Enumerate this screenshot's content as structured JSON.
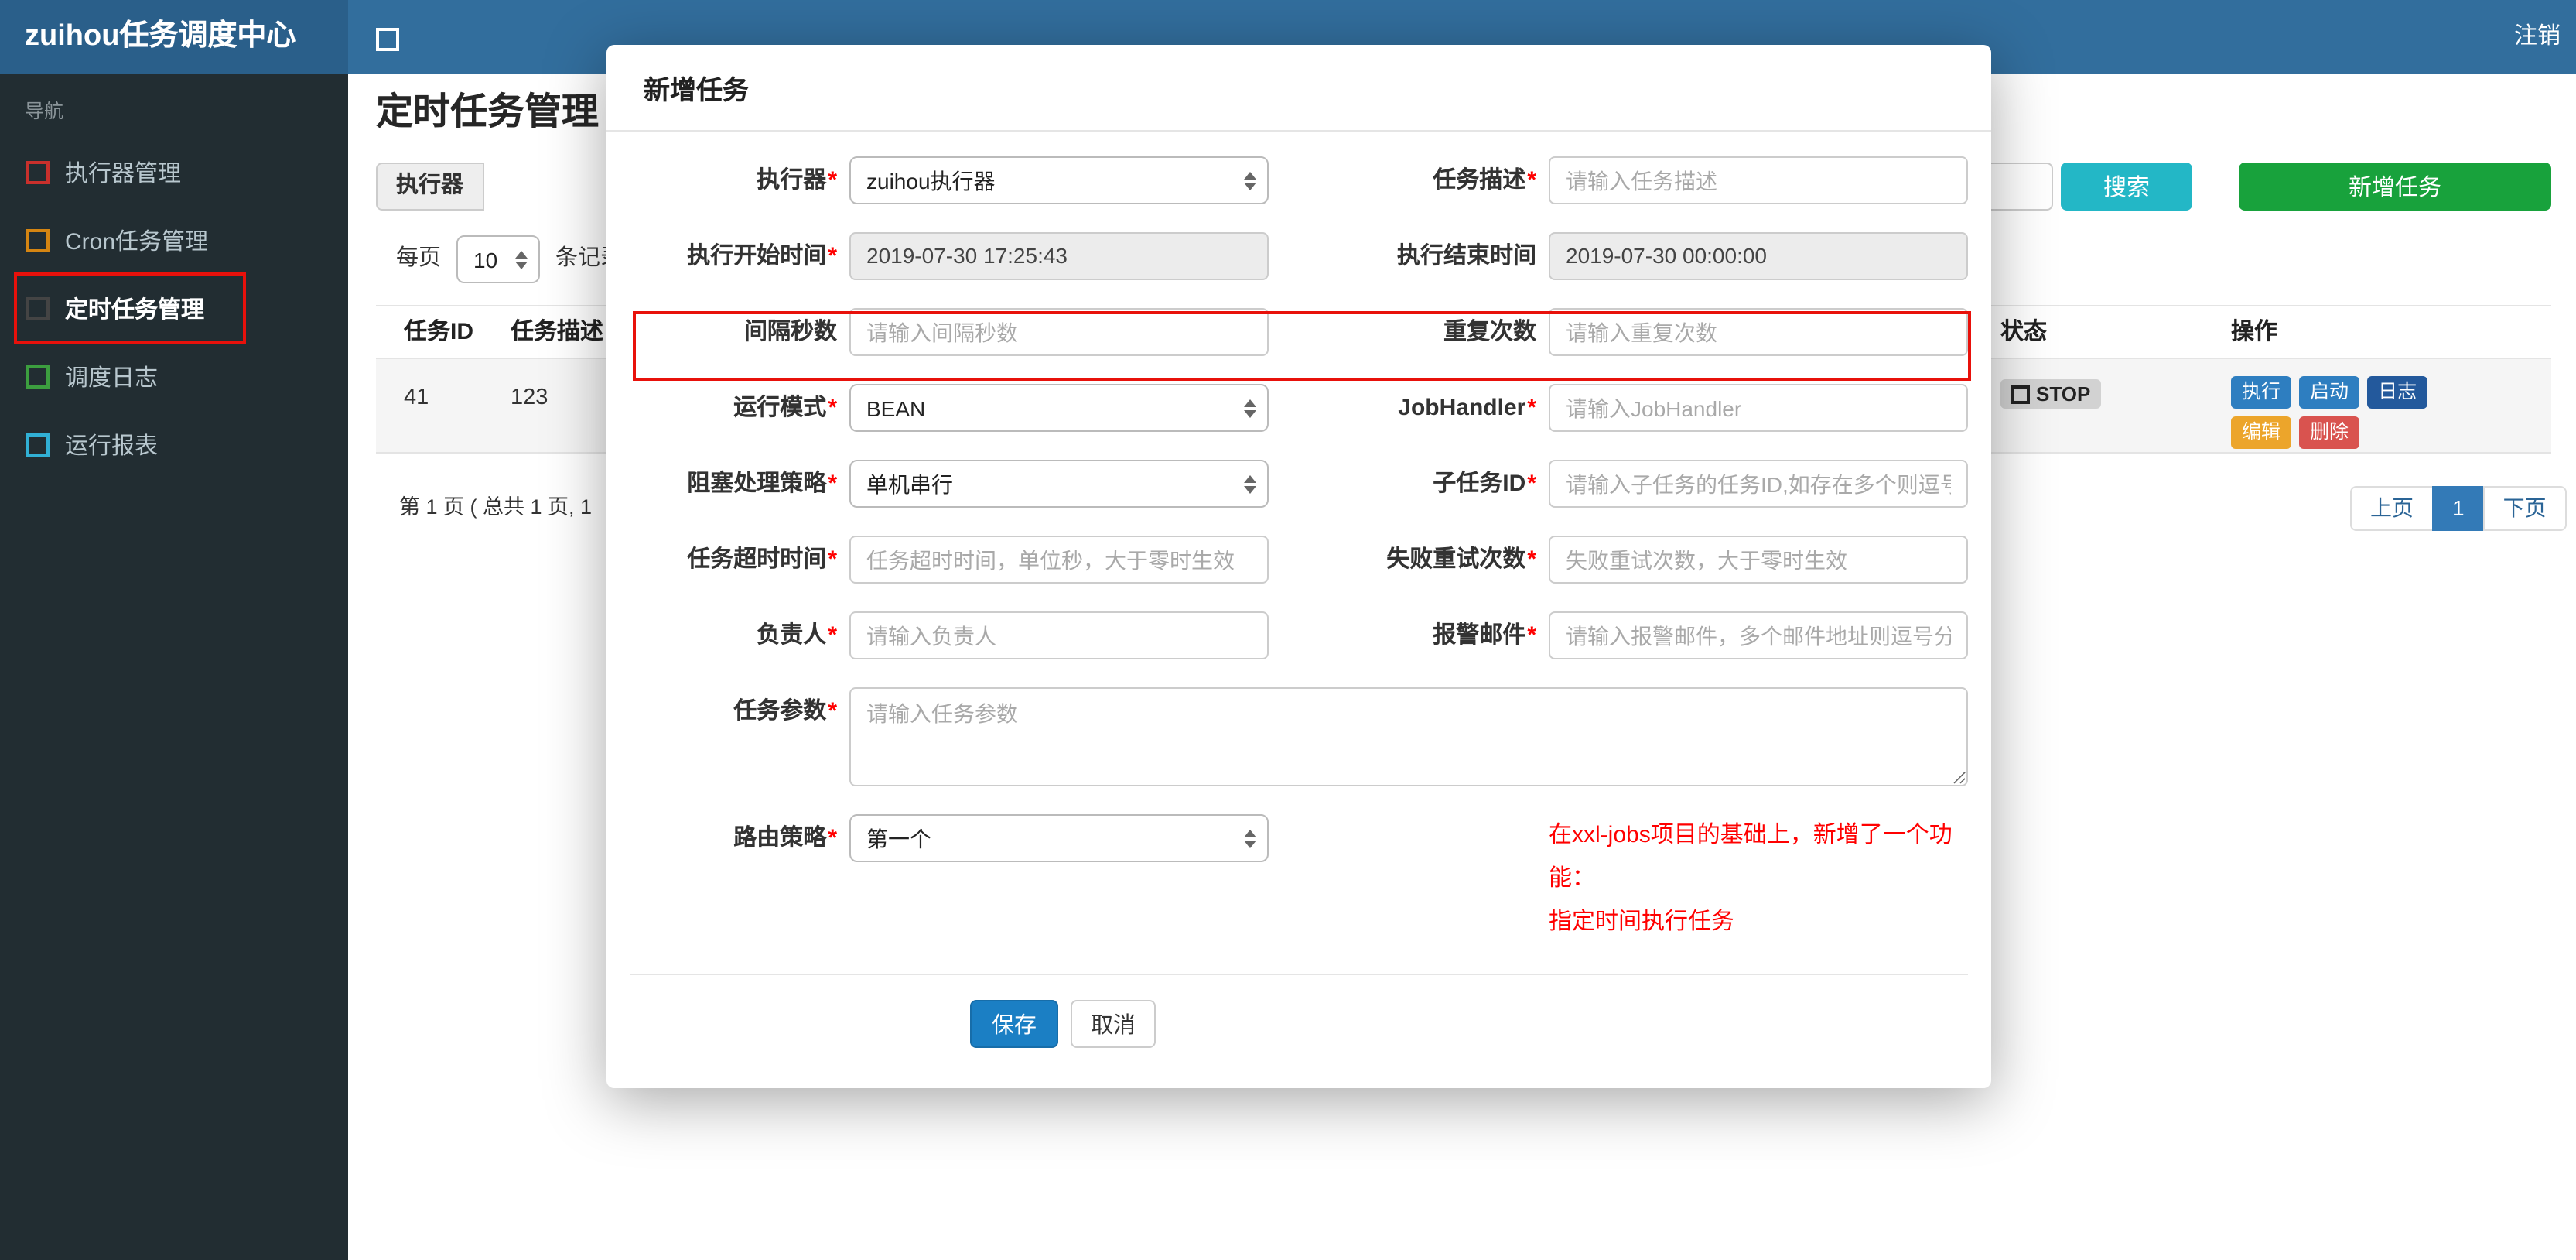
{
  "colors": {
    "navbar": "#326e9d",
    "brand_bg": "#2a5f8a",
    "sidebar_bg": "#222d32",
    "search_button": "#23b7c6",
    "add_button": "#18a23c",
    "save_button": "#1b7fc4",
    "annotation": "#e8110b",
    "active_page": "#337ab7"
  },
  "topbar": {
    "brand": "zuihou任务调度中心",
    "logout": "注销"
  },
  "sidebar": {
    "header": "导航",
    "items": [
      {
        "label": "执行器管理",
        "color": "#c9302c",
        "active": false
      },
      {
        "label": "Cron任务管理",
        "color": "#d58512",
        "active": false
      },
      {
        "label": "定时任务管理",
        "color": "#444444",
        "active": true
      },
      {
        "label": "调度日志",
        "color": "#3c9e3f",
        "active": false
      },
      {
        "label": "运行报表",
        "color": "#31b0d5",
        "active": false
      }
    ]
  },
  "page": {
    "title": "定时任务管理",
    "filter": {
      "executor_label": "执行器",
      "search_button": "搜索",
      "add_button": "新增任务"
    },
    "per_page": {
      "prefix": "每页",
      "value": "10",
      "suffix": "条记录"
    },
    "table": {
      "headers": [
        "任务ID",
        "任务描述",
        "状态",
        "操作"
      ],
      "row": {
        "id": "41",
        "desc": "123",
        "status": "STOP"
      },
      "actions": [
        "执行",
        "启动",
        "日志",
        "编辑",
        "删除"
      ],
      "action_colors": {
        "execute": "#2e7ec0",
        "start": "#2e7ec0",
        "log": "#23599c",
        "edit": "#eca52b",
        "delete": "#d9534f"
      }
    },
    "pagination": {
      "summary": "第 1 页 ( 总共 1 页, 1",
      "prev": "上页",
      "current": "1",
      "next": "下页"
    }
  },
  "modal": {
    "title": "新增任务",
    "required_mark": "*",
    "rows": [
      {
        "left": {
          "label": "执行器",
          "required": true,
          "type": "select",
          "value": "zuihou执行器"
        },
        "right": {
          "label": "任务描述",
          "required": true,
          "type": "input",
          "placeholder": "请输入任务描述"
        }
      },
      {
        "left": {
          "label": "执行开始时间",
          "required": true,
          "type": "readonly",
          "value": "2019-07-30 17:25:43"
        },
        "right": {
          "label": "执行结束时间",
          "required": false,
          "type": "readonly",
          "value": "2019-07-30 00:00:00"
        }
      },
      {
        "left": {
          "label": "间隔秒数",
          "required": false,
          "type": "input",
          "placeholder": "请输入间隔秒数"
        },
        "right": {
          "label": "重复次数",
          "required": false,
          "type": "input",
          "placeholder": "请输入重复次数"
        }
      },
      {
        "left": {
          "label": "运行模式",
          "required": true,
          "type": "select",
          "value": "BEAN"
        },
        "right": {
          "label": "JobHandler",
          "required": true,
          "type": "input",
          "placeholder": "请输入JobHandler"
        }
      },
      {
        "left": {
          "label": "阻塞处理策略",
          "required": true,
          "type": "select",
          "value": "单机串行"
        },
        "right": {
          "label": "子任务ID",
          "required": true,
          "type": "input",
          "placeholder": "请输入子任务的任务ID,如存在多个则逗号分隔"
        }
      },
      {
        "left": {
          "label": "任务超时时间",
          "required": true,
          "type": "input",
          "placeholder": "任务超时时间，单位秒，大于零时生效"
        },
        "right": {
          "label": "失败重试次数",
          "required": true,
          "type": "input",
          "placeholder": "失败重试次数，大于零时生效"
        }
      },
      {
        "left": {
          "label": "负责人",
          "required": true,
          "type": "input",
          "placeholder": "请输入负责人"
        },
        "right": {
          "label": "报警邮件",
          "required": true,
          "type": "input",
          "placeholder": "请输入报警邮件，多个邮件地址则逗号分隔"
        }
      }
    ],
    "textarea": {
      "label": "任务参数",
      "required": true,
      "placeholder": "请输入任务参数"
    },
    "route": {
      "label": "路由策略",
      "required": true,
      "value": "第一个"
    },
    "hint_line1": "在xxl-jobs项目的基础上，新增了一个功能：",
    "hint_line2": "指定时间执行任务",
    "save": "保存",
    "cancel": "取消"
  }
}
